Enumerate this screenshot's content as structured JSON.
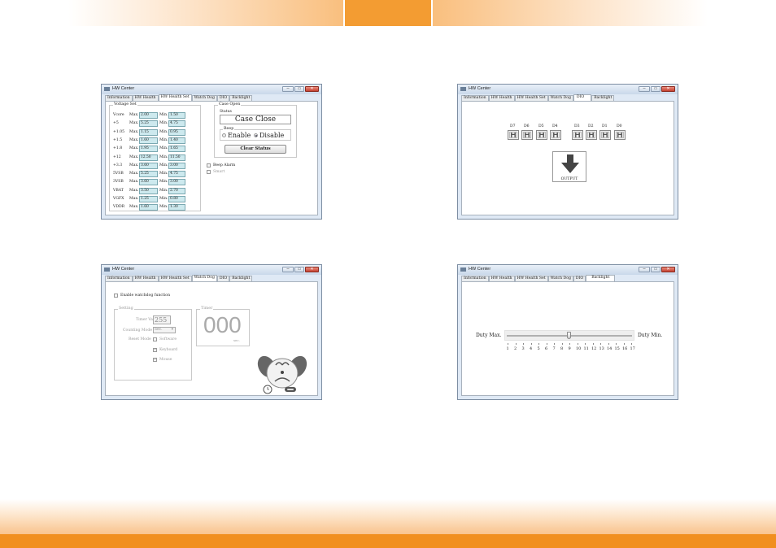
{
  "common": {
    "app_title": "HW Center",
    "win_min": "─",
    "win_max": "▭",
    "win_close": "✕"
  },
  "tabs": [
    "Information",
    "HW Health",
    "HW Health Set",
    "Watch Dog",
    "DIO",
    "Backlight"
  ],
  "hwset": {
    "voltage_group": "Voltage Set",
    "max_label": "Max.",
    "min_label": "Min.",
    "rows": [
      {
        "name": "Vcore",
        "max": "2.00",
        "min": "1.50"
      },
      {
        "name": "+5",
        "max": "5.25",
        "min": "4.75"
      },
      {
        "name": "+1.05",
        "max": "1.15",
        "min": "0.95"
      },
      {
        "name": "+1.5",
        "max": "1.60",
        "min": "1.40"
      },
      {
        "name": "+1.8",
        "max": "1.95",
        "min": "1.65"
      },
      {
        "name": "+12",
        "max": "12.50",
        "min": "11.50"
      },
      {
        "name": "+3.3",
        "max": "3.60",
        "min": "3.00"
      },
      {
        "name": "5VSB",
        "max": "5.25",
        "min": "4.75"
      },
      {
        "name": "3VSB",
        "max": "3.60",
        "min": "3.00"
      },
      {
        "name": "VBAT",
        "max": "3.50",
        "min": "2.70"
      },
      {
        "name": "VGFX",
        "max": "1.25",
        "min": "0.80"
      },
      {
        "name": "VDDR",
        "max": "1.60",
        "min": "1.30"
      }
    ],
    "case_group": "Case Open",
    "status_label": "Status",
    "status_value": "Case Close",
    "beep_label": "Beep",
    "enable": "Enable",
    "disable": "Disable",
    "clear": "Clear Status",
    "beep_alarm": "Beep Alarm",
    "smart": "Smart"
  },
  "dio": {
    "bits": [
      "D7",
      "D6",
      "D5",
      "D4",
      "D3",
      "D2",
      "D1",
      "D0"
    ],
    "value": "H",
    "output": "OUTPUT"
  },
  "wdog": {
    "enable": "Enable watchdog function",
    "setting": "Setting",
    "timer_value_label": "Timer Value",
    "timer_value": "255",
    "counting_mode_label": "Counting Mode",
    "counting_mode": "Sec.",
    "reset_mode_label": "Reset Mode",
    "software": "Software",
    "keyboard": "Keyboard",
    "mouse": "Mouse",
    "timer_group": "Timer",
    "timer_display": "000",
    "timer_unit": "sec."
  },
  "backlight": {
    "duty_max": "Duty Max.",
    "duty_min": "Duty Min.",
    "ticks": [
      "1",
      "2",
      "3",
      "4",
      "5",
      "6",
      "7",
      "8",
      "9",
      "10",
      "11",
      "12",
      "13",
      "14",
      "15",
      "16",
      "17"
    ],
    "level": 8
  }
}
